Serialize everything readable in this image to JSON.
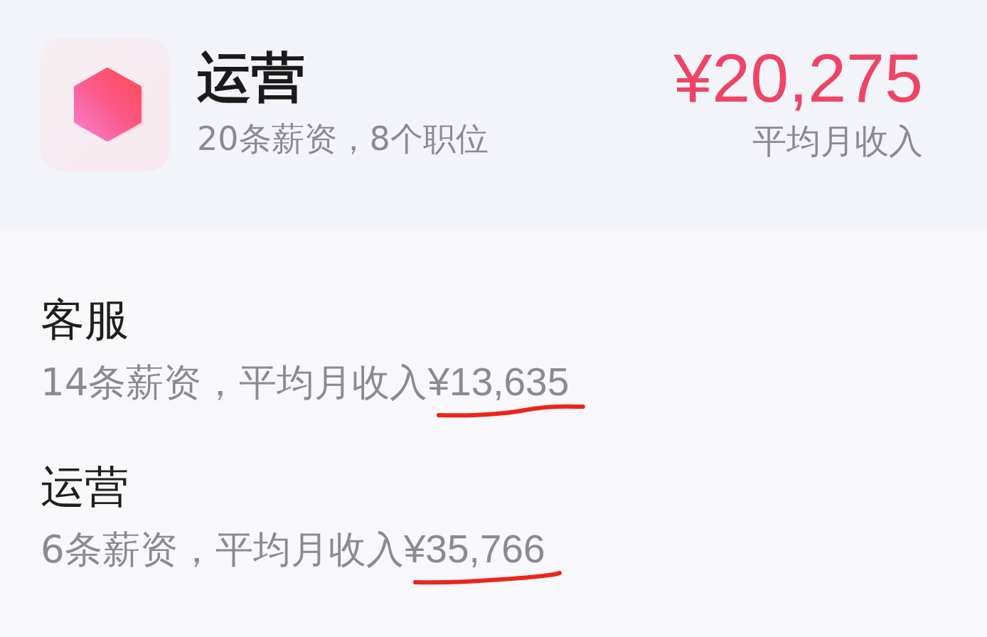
{
  "category": {
    "title": "运营",
    "subtitle": "20条薪资，8个职位",
    "average": "¥20,275",
    "average_label": "平均月收入"
  },
  "jobs": [
    {
      "title": "客服",
      "summary": "14条薪资，平均月收入",
      "average": "¥13,635",
      "underlined": true
    },
    {
      "title": "运营",
      "summary": "6条薪资，平均月收入",
      "average": "¥35,766",
      "underlined": true
    }
  ]
}
